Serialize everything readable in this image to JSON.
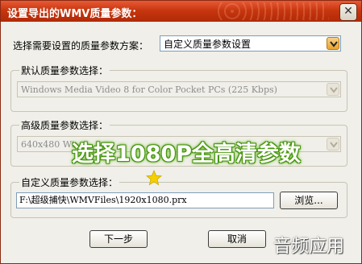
{
  "window": {
    "title": "设置导出的WMV质量参数：",
    "close_glyph": "✕"
  },
  "scheme": {
    "label": "选择需要设置的质量参数方案：",
    "value": "自定义质量参数设置"
  },
  "default_group": {
    "title": "默认质量参数选择：",
    "value": "Windows Media Video 8 for Color Pocket PCs (225 Kbps)"
  },
  "advanced_group": {
    "title": "高级质量参数选择：",
    "value": "640x480 Wi"
  },
  "custom_group": {
    "title": "自定义质量参数选择：",
    "path": "F:\\超级捕快\\WMVFiles\\1920x1080.prx",
    "browse_label": "浏览..."
  },
  "buttons": {
    "next_label": "下一步",
    "cancel_label": "取消"
  },
  "overlay": {
    "text": "选择1080P全高清参数"
  },
  "watermark": {
    "text": "音频应用"
  },
  "colors": {
    "title_bar": "#c7360f",
    "overlay_glow": "#4c9a10",
    "star": "#f5d000"
  },
  "icons": {
    "dropdown": "chevron-down-icon",
    "star": "star-icon"
  }
}
